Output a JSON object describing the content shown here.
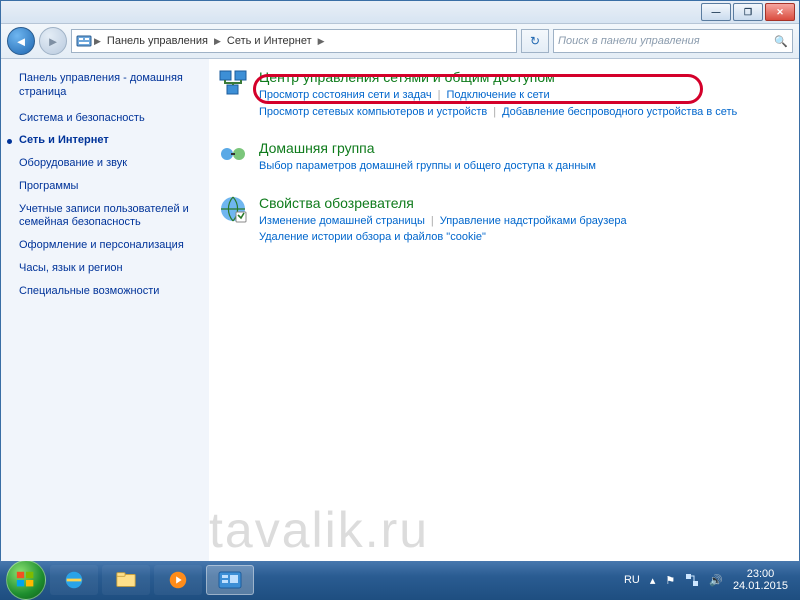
{
  "breadcrumb": {
    "root": "Панель управления",
    "section": "Сеть и Интернет"
  },
  "search": {
    "placeholder": "Поиск в панели управления"
  },
  "sidebar": {
    "heading": "Панель управления - домашняя страница",
    "items": [
      "Система и безопасность",
      "Сеть и Интернет",
      "Оборудование и звук",
      "Программы",
      "Учетные записи пользователей и семейная безопасность",
      "Оформление и персонализация",
      "Часы, язык и регион",
      "Специальные возможности"
    ],
    "active_index": 1
  },
  "sections": [
    {
      "title": "Центр управления сетями и общим доступом",
      "subs": [
        "Просмотр состояния сети и задач",
        "Подключение к сети",
        "Просмотр сетевых компьютеров и устройств",
        "Добавление беспроводного устройства в сеть"
      ],
      "sub_breaks": [
        1,
        3
      ]
    },
    {
      "title": "Домашняя группа",
      "subs": [
        "Выбор параметров домашней группы и общего доступа к данным"
      ],
      "sub_breaks": []
    },
    {
      "title": "Свойства обозревателя",
      "subs": [
        "Изменение домашней страницы",
        "Управление надстройками браузера",
        "Удаление истории обзора и файлов \"cookie\""
      ],
      "sub_breaks": [
        1
      ]
    }
  ],
  "tray": {
    "lang": "RU",
    "time": "23:00",
    "date": "24.01.2015"
  },
  "watermark": "tavalik.ru"
}
